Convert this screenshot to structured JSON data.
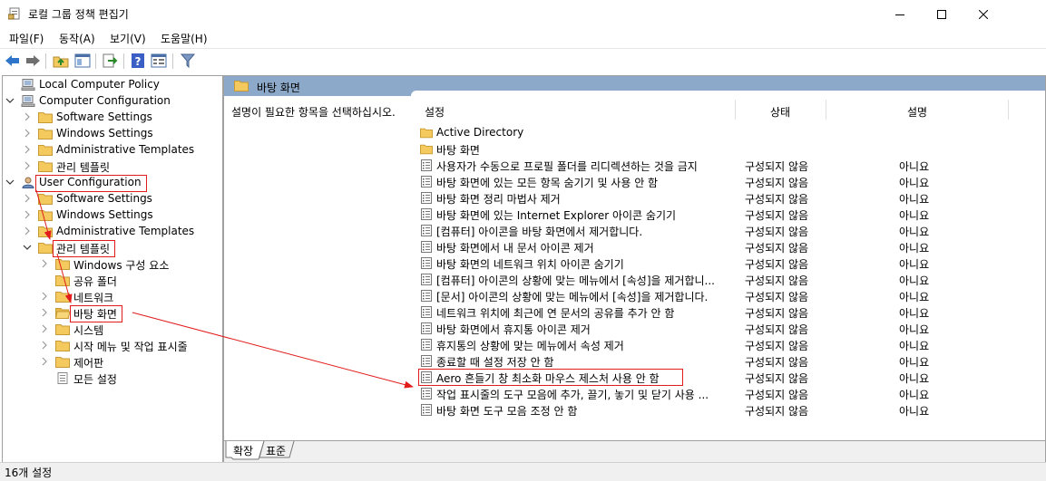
{
  "window": {
    "title": "로컬 그룹 정책 편집기",
    "controls": [
      "minimize",
      "maximize",
      "close"
    ]
  },
  "menu": [
    {
      "label": "파일(F)"
    },
    {
      "label": "동작(A)"
    },
    {
      "label": "보기(V)"
    },
    {
      "label": "도움말(H)"
    }
  ],
  "toolbar": [
    "back-arrow-icon",
    "forward-arrow-icon",
    "up-folder-icon",
    "show-hide-tree-icon",
    "export-list-icon",
    "help-icon",
    "properties-icon",
    "filter-icon"
  ],
  "tree": {
    "items": [
      {
        "label": "Local Computer Policy",
        "expanded": true,
        "icon": "computer-icon"
      },
      {
        "label": "Computer Configuration",
        "expanded": true,
        "icon": "computer-icon"
      },
      {
        "label": "Software Settings",
        "icon": "folder-icon"
      },
      {
        "label": "Windows Settings",
        "icon": "folder-icon"
      },
      {
        "label": "Administrative Templates",
        "icon": "folder-icon"
      },
      {
        "label": "관리 템플릿",
        "icon": "folder-icon"
      },
      {
        "label": "User Configuration",
        "expanded": true,
        "icon": "user-icon",
        "highlighted": true
      },
      {
        "label": "Software Settings",
        "icon": "folder-icon"
      },
      {
        "label": "Windows Settings",
        "icon": "folder-icon"
      },
      {
        "label": "Administrative Templates",
        "icon": "folder-icon"
      },
      {
        "label": "관리 템플릿",
        "expanded": true,
        "icon": "folder-icon",
        "highlighted": true
      },
      {
        "label": "Windows 구성 요소",
        "icon": "folder-icon"
      },
      {
        "label": "공유 폴더",
        "icon": "folder-icon"
      },
      {
        "label": "네트워크",
        "icon": "folder-icon"
      },
      {
        "label": "바탕 화면",
        "icon": "folder-open-icon",
        "selected": true,
        "highlighted": true
      },
      {
        "label": "시스템",
        "icon": "folder-icon"
      },
      {
        "label": "시작 메뉴 및 작업 표시줄",
        "icon": "folder-icon"
      },
      {
        "label": "제어판",
        "icon": "folder-icon"
      },
      {
        "label": "모든 설정",
        "icon": "all-settings-icon"
      }
    ]
  },
  "right": {
    "header": "바탕 화면",
    "description": "설명이 필요한 항목을 선택하십시오.",
    "columns": {
      "name": "설정",
      "state": "상태",
      "comment": "설명"
    },
    "folders": [
      "Active Directory",
      "바탕 화면"
    ],
    "policies": [
      {
        "name": "사용자가 수동으로 프로필 폴더를 리디렉션하는 것을 금지",
        "state": "구성되지 않음",
        "comment": "아니요"
      },
      {
        "name": "바탕 화면에 있는 모든 항목 숨기기 및 사용 안 함",
        "state": "구성되지 않음",
        "comment": "아니요"
      },
      {
        "name": "바탕 화면 정리 마법사 제거",
        "state": "구성되지 않음",
        "comment": "아니요"
      },
      {
        "name": "바탕 화면에 있는 Internet Explorer 아이콘 숨기기",
        "state": "구성되지 않음",
        "comment": "아니요"
      },
      {
        "name": "[컴퓨터] 아이콘을 바탕 화면에서 제거합니다.",
        "state": "구성되지 않음",
        "comment": "아니요"
      },
      {
        "name": "바탕 화면에서 내 문서 아이콘 제거",
        "state": "구성되지 않음",
        "comment": "아니요"
      },
      {
        "name": "바탕 화면의 네트워크 위치 아이콘 숨기기",
        "state": "구성되지 않음",
        "comment": "아니요"
      },
      {
        "name": "[컴퓨터] 아이콘의 상황에 맞는 메뉴에서 [속성]을 제거합니...",
        "state": "구성되지 않음",
        "comment": "아니요"
      },
      {
        "name": "[문서] 아이콘의 상황에 맞는 메뉴에서 [속성]을 제거합니다.",
        "state": "구성되지 않음",
        "comment": "아니요"
      },
      {
        "name": "네트워크 위치에 최근에 연 문서의 공유를 추가 안 함",
        "state": "구성되지 않음",
        "comment": "아니요"
      },
      {
        "name": "바탕 화면에서 휴지통 아이콘 제거",
        "state": "구성되지 않음",
        "comment": "아니요"
      },
      {
        "name": "휴지통의 상황에 맞는 메뉴에서 속성 제거",
        "state": "구성되지 않음",
        "comment": "아니요"
      },
      {
        "name": "종료할 때 설정 저장 안 함",
        "state": "구성되지 않음",
        "comment": "아니요"
      },
      {
        "name": "Aero 흔들기 창 최소화 마우스 제스처 사용 안 함",
        "state": "구성되지 않음",
        "comment": "아니요",
        "highlighted": true
      },
      {
        "name": "작업 표시줄의 도구 모음에 추가, 끌기, 놓기 및 닫기 사용 ...",
        "state": "구성되지 않음",
        "comment": "아니요"
      },
      {
        "name": "바탕 화면 도구 모음 조정 안 함",
        "state": "구성되지 않음",
        "comment": "아니요"
      }
    ],
    "tabs": [
      {
        "label": "확장",
        "active": true
      },
      {
        "label": "표준",
        "active": false
      }
    ]
  },
  "status": "16개 설정",
  "colors": {
    "header": "#8ca9c9",
    "annotation": "#e21b1b",
    "folder": "#f4c95d"
  }
}
